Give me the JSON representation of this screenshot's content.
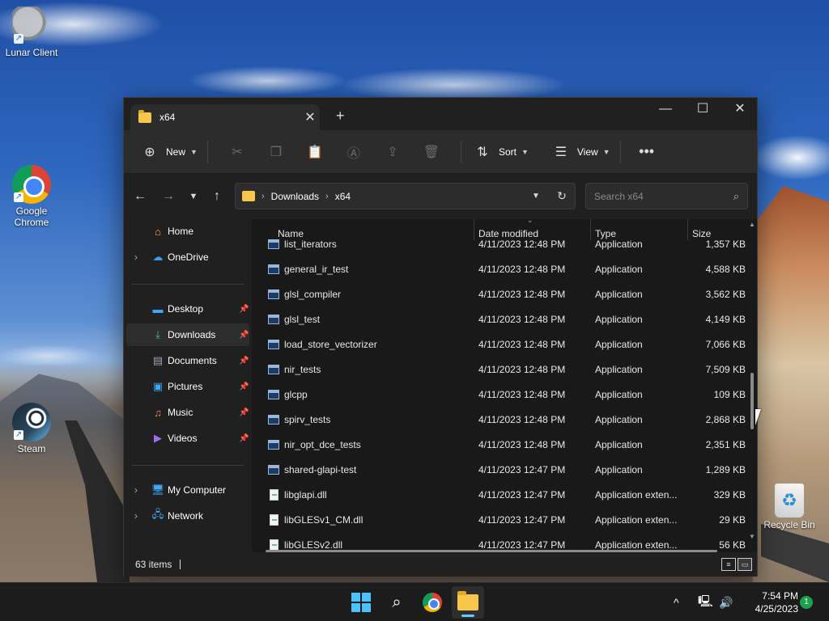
{
  "desktop": {
    "icons": [
      {
        "label": "Lunar Client"
      },
      {
        "label": "Google Chrome"
      },
      {
        "label": "Steam"
      },
      {
        "label": "Recycle Bin"
      }
    ]
  },
  "window": {
    "tab_title": "x64",
    "toolbar": {
      "new_label": "New",
      "sort_label": "Sort",
      "view_label": "View"
    },
    "address": {
      "crumbs": [
        "Downloads",
        "x64"
      ]
    },
    "search": {
      "placeholder": "Search x64"
    },
    "sidebar": {
      "items": [
        {
          "label": "Home",
          "icon": "home-icon"
        },
        {
          "label": "OneDrive",
          "icon": "cloud-icon"
        },
        {
          "label": "Desktop",
          "icon": "desktop-icon"
        },
        {
          "label": "Downloads",
          "icon": "download-icon"
        },
        {
          "label": "Documents",
          "icon": "document-icon"
        },
        {
          "label": "Pictures",
          "icon": "picture-icon"
        },
        {
          "label": "Music",
          "icon": "music-icon"
        },
        {
          "label": "Videos",
          "icon": "video-icon"
        },
        {
          "label": "My Computer",
          "icon": "computer-icon"
        },
        {
          "label": "Network",
          "icon": "network-icon"
        }
      ]
    },
    "columns": {
      "name": "Name",
      "date": "Date modified",
      "type": "Type",
      "size": "Size"
    },
    "files": [
      {
        "name": "list_iterators",
        "date": "4/11/2023 12:48 PM",
        "type": "Application",
        "size": "1,357 KB"
      },
      {
        "name": "general_ir_test",
        "date": "4/11/2023 12:48 PM",
        "type": "Application",
        "size": "4,588 KB"
      },
      {
        "name": "glsl_compiler",
        "date": "4/11/2023 12:48 PM",
        "type": "Application",
        "size": "3,562 KB"
      },
      {
        "name": "glsl_test",
        "date": "4/11/2023 12:48 PM",
        "type": "Application",
        "size": "4,149 KB"
      },
      {
        "name": "load_store_vectorizer",
        "date": "4/11/2023 12:48 PM",
        "type": "Application",
        "size": "7,066 KB"
      },
      {
        "name": "nir_tests",
        "date": "4/11/2023 12:48 PM",
        "type": "Application",
        "size": "7,509 KB"
      },
      {
        "name": "glcpp",
        "date": "4/11/2023 12:48 PM",
        "type": "Application",
        "size": "109 KB"
      },
      {
        "name": "spirv_tests",
        "date": "4/11/2023 12:48 PM",
        "type": "Application",
        "size": "2,868 KB"
      },
      {
        "name": "nir_opt_dce_tests",
        "date": "4/11/2023 12:48 PM",
        "type": "Application",
        "size": "2,351 KB"
      },
      {
        "name": "shared-glapi-test",
        "date": "4/11/2023 12:47 PM",
        "type": "Application",
        "size": "1,289 KB"
      },
      {
        "name": "libglapi.dll",
        "date": "4/11/2023 12:47 PM",
        "type": "Application exten...",
        "size": "329 KB"
      },
      {
        "name": "libGLESv1_CM.dll",
        "date": "4/11/2023 12:47 PM",
        "type": "Application exten...",
        "size": "29 KB"
      },
      {
        "name": "libGLESv2.dll",
        "date": "4/11/2023 12:47 PM",
        "type": "Application exten...",
        "size": "56 KB"
      }
    ],
    "status": {
      "item_count": "63 items"
    }
  },
  "taskbar": {
    "time": "7:54 PM",
    "date": "4/25/2023",
    "notification_count": "1"
  }
}
